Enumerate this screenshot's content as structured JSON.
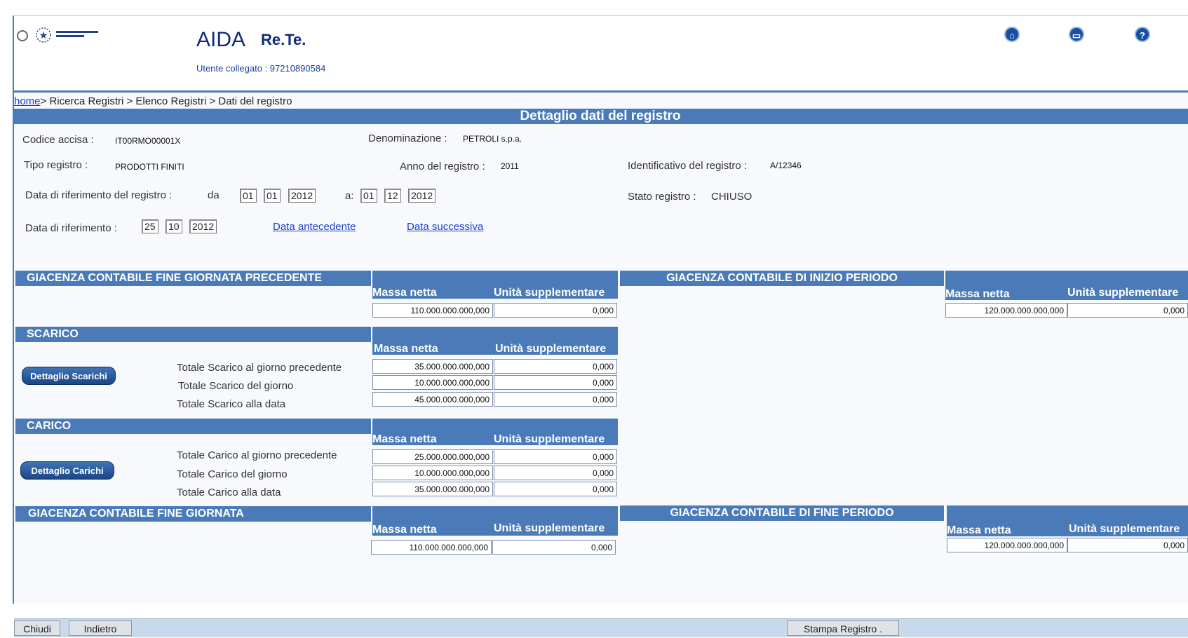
{
  "header": {
    "title": "AIDA",
    "subtitle": "Re.Te.",
    "user_line": "Utente collegato : 97210890584",
    "icons": [
      "home-icon",
      "print-icon",
      "help-icon"
    ]
  },
  "breadcrumb": {
    "home": "home",
    "rest": "> Ricerca Registri > Elenco Registri > Dati del registro"
  },
  "page_title": "Dettaglio dati del registro",
  "fields": {
    "codice_label": "Codice accisa :",
    "codice_value": "IT00RMO00001X",
    "denom_label": "Denominazione :",
    "denom_value": "PETROLI s.p.a.",
    "tipo_label": "Tipo registro :",
    "tipo_value": "PRODOTTI FINITI",
    "anno_label": "Anno del registro :",
    "anno_value": "2011",
    "ident_label": "Identificativo del registro :",
    "ident_value": "A/12346",
    "rif_registro_label": "Data di riferimento del registro :",
    "da": "da",
    "a": "a:",
    "from": {
      "d": "01",
      "m": "01",
      "y": "2012"
    },
    "to": {
      "d": "01",
      "m": "12",
      "y": "2012"
    },
    "stato_label": "Stato registro :",
    "stato_value": "CHIUSO",
    "rif_label": "Data di riferimento :",
    "rif": {
      "d": "25",
      "m": "10",
      "y": "2012"
    },
    "prev_link": "Data antecedente",
    "next_link": "Data successiva"
  },
  "cols": {
    "massa": "Massa netta",
    "unita": "Unità supplementare"
  },
  "sections": {
    "giac_prec": {
      "title": "GIACENZA CONTABILE FINE GIORNATA PRECEDENTE",
      "massa": "110.000.000.000,000",
      "unita": "0,000"
    },
    "giac_inizio": {
      "title": "GIACENZA CONTABILE DI INIZIO PERIODO",
      "massa": "120.000.000.000,000",
      "unita": "0,000"
    },
    "scarico": {
      "title": "SCARICO",
      "button": "Dettaglio Scarichi",
      "rows": [
        {
          "label": "Totale Scarico al giorno precedente",
          "massa": "35.000.000.000,000",
          "unita": "0,000"
        },
        {
          "label": "Totale Scarico del giorno",
          "massa": "10.000.000.000,000",
          "unita": "0,000"
        },
        {
          "label": "Totale Scarico alla data",
          "massa": "45.000.000.000,000",
          "unita": "0,000"
        }
      ]
    },
    "carico": {
      "title": "CARICO",
      "button": "Dettaglio Carichi",
      "rows": [
        {
          "label": "Totale Carico al giorno precedente",
          "massa": "25.000.000.000,000",
          "unita": "0,000"
        },
        {
          "label": "Totale Carico del giorno",
          "massa": "10.000.000.000,000",
          "unita": "0,000"
        },
        {
          "label": "Totale Carico alla data",
          "massa": "35.000.000.000,000",
          "unita": "0,000"
        }
      ]
    },
    "giac_fine": {
      "title": "GIACENZA CONTABILE FINE GIORNATA",
      "massa": "110.000.000.000,000",
      "unita": "0,000"
    },
    "giac_fine_periodo": {
      "title": "GIACENZA CONTABILE DI FINE PERIODO",
      "massa": "120.000.000.000,000",
      "unita": "0,000"
    }
  },
  "footer": {
    "chiudi": "Chiudi",
    "indietro": "Indietro",
    "stampa": "Stampa Registro ."
  }
}
